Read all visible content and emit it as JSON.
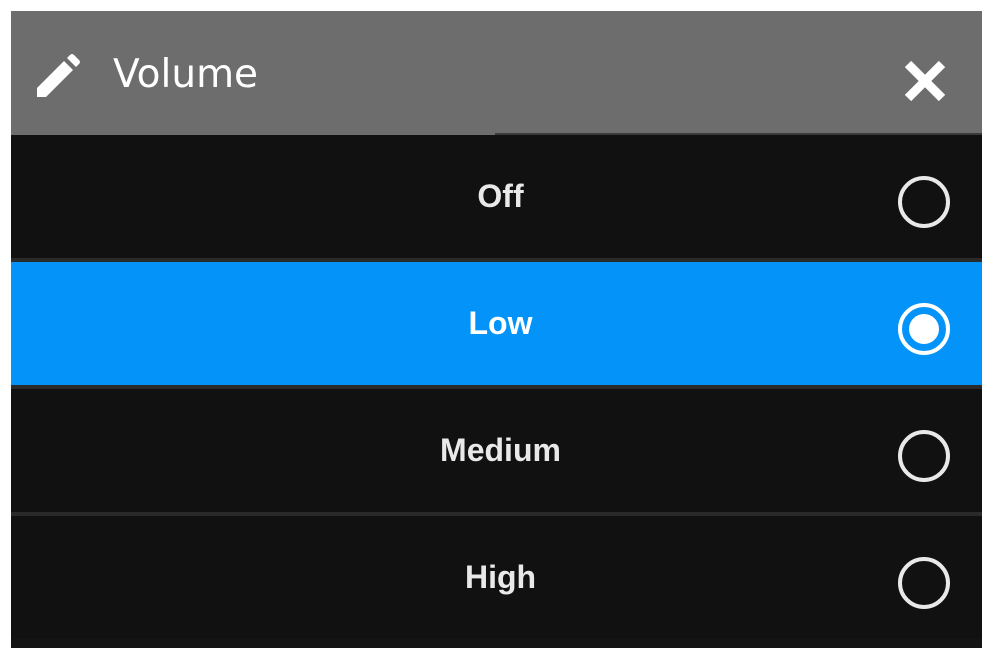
{
  "dialog": {
    "title": "Volume",
    "edit_icon": "pencil-icon",
    "close_icon": "close-icon"
  },
  "options": [
    {
      "label": "Off",
      "selected": false
    },
    {
      "label": "Low",
      "selected": true
    },
    {
      "label": "Medium",
      "selected": false
    },
    {
      "label": "High",
      "selected": false
    }
  ],
  "colors": {
    "header_bg": "#6d6d6d",
    "list_bg": "#111111",
    "selected_bg": "#0494f9",
    "text": "#e9e9e9",
    "radio": "#e9e9e9"
  }
}
